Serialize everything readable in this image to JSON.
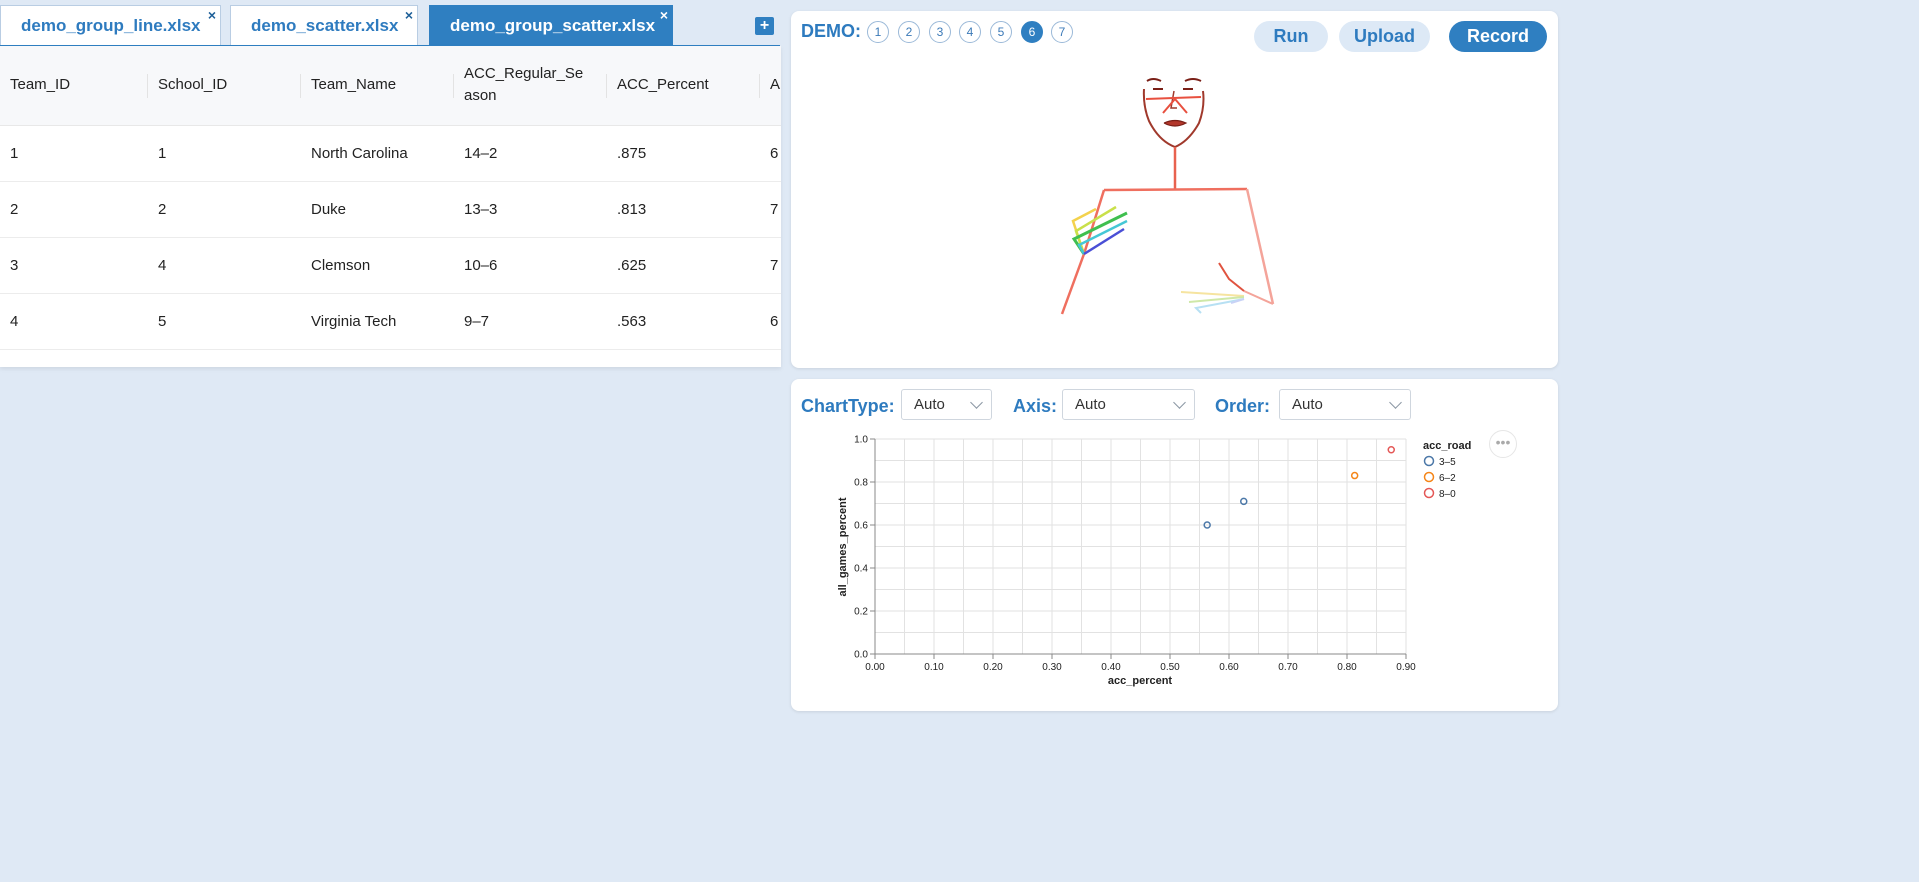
{
  "tabs": [
    {
      "label": "demo_group_line.xlsx",
      "close": "×",
      "active": false
    },
    {
      "label": "demo_scatter.xlsx",
      "close": "×",
      "active": false
    },
    {
      "label": "demo_group_scatter.xlsx",
      "close": "×",
      "active": true
    }
  ],
  "add_tab_label": "+",
  "table": {
    "columns": [
      "Team_ID",
      "School_ID",
      "Team_Name",
      "ACC_Regular_Season",
      "ACC_Percent",
      "A"
    ],
    "rows": [
      [
        "1",
        "1",
        "North Carolina",
        "14–2",
        ".875",
        "6"
      ],
      [
        "2",
        "2",
        "Duke",
        "13–3",
        ".813",
        "7"
      ],
      [
        "3",
        "4",
        "Clemson",
        "10–6",
        ".625",
        "7"
      ],
      [
        "4",
        "5",
        "Virginia Tech",
        "9–7",
        ".563",
        "6"
      ]
    ]
  },
  "demo": {
    "label": "DEMO:",
    "numbers": [
      "1",
      "2",
      "3",
      "4",
      "5",
      "6",
      "7"
    ],
    "active_index": 5,
    "buttons": {
      "run": "Run",
      "upload": "Upload",
      "record": "Record"
    }
  },
  "controls": {
    "chart_type": {
      "label": "ChartType:",
      "value": "Auto"
    },
    "axis": {
      "label": "Axis:",
      "value": "Auto"
    },
    "order": {
      "label": "Order:",
      "value": "Auto"
    },
    "more": "•••"
  },
  "colors": {
    "accent": "#2f7fc1",
    "series_3_5": "#4c78a8",
    "series_6_2": "#f58518",
    "series_8_0": "#e45756"
  },
  "chart_data": {
    "type": "scatter",
    "xlabel": "acc_percent",
    "ylabel": "all_games_percent",
    "xlim": [
      0,
      0.9
    ],
    "ylim": [
      0,
      1.0
    ],
    "x_ticks": [
      "0.00",
      "0.10",
      "0.20",
      "0.30",
      "0.40",
      "0.50",
      "0.60",
      "0.70",
      "0.80",
      "0.90"
    ],
    "y_ticks": [
      "0.0",
      "0.2",
      "0.4",
      "0.6",
      "0.8",
      "1.0"
    ],
    "grid": true,
    "legend_title": "acc_road",
    "legend_position": "right",
    "series": [
      {
        "name": "3–5",
        "color": "#4c78a8",
        "points": [
          [
            0.563,
            0.6
          ],
          [
            0.625,
            0.71
          ]
        ]
      },
      {
        "name": "6–2",
        "color": "#f58518",
        "points": [
          [
            0.813,
            0.83
          ]
        ]
      },
      {
        "name": "8–0",
        "color": "#e45756",
        "points": [
          [
            0.875,
            0.95
          ]
        ]
      }
    ]
  }
}
